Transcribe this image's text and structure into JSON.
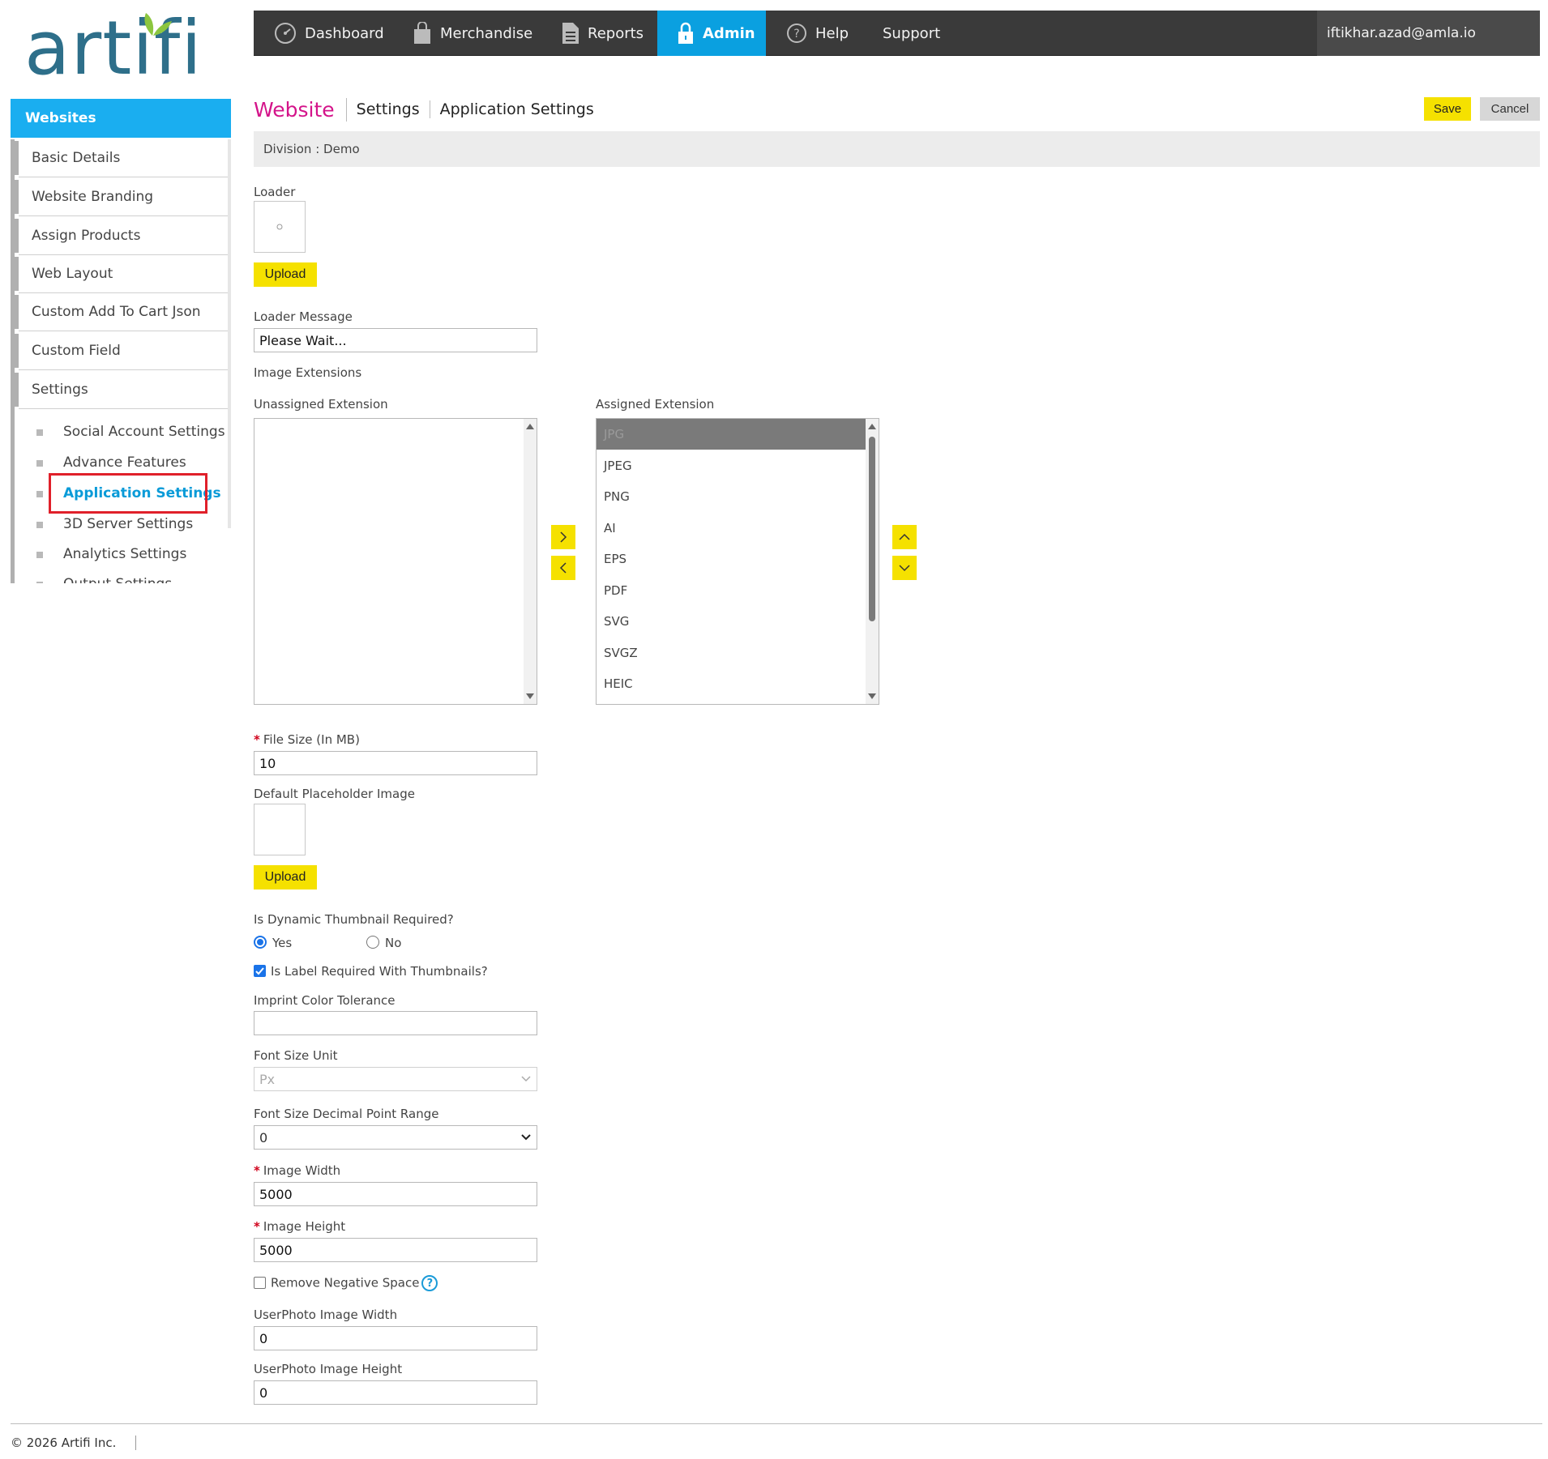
{
  "logo": {
    "text": "artifi"
  },
  "topnav": {
    "items": [
      {
        "label": "Dashboard",
        "icon": "gauge-icon"
      },
      {
        "label": "Merchandise",
        "icon": "bag-icon"
      },
      {
        "label": "Reports",
        "icon": "document-icon"
      },
      {
        "label": "Admin",
        "icon": "lock-icon",
        "active": true
      },
      {
        "label": "Help",
        "icon": "help-circle-icon"
      },
      {
        "label": "Support"
      }
    ],
    "user": "iftikhar.azad@amla.io"
  },
  "sidebar": {
    "header": "Websites",
    "items": [
      "Basic Details",
      "Website Branding",
      "Assign Products",
      "Web Layout",
      "Custom Add To Cart Json",
      "Custom Field",
      "Settings"
    ],
    "sub_items": [
      "Social Account Settings",
      "Advance Features",
      "Application Settings",
      "3D Server Settings",
      "Analytics Settings",
      "Output Settings"
    ],
    "current": "Application Settings"
  },
  "breadcrumb": {
    "part1": "Website",
    "part2": "Settings",
    "part3": "Application Settings"
  },
  "actions": {
    "save": "Save",
    "cancel": "Cancel"
  },
  "division": {
    "label": "Division :",
    "value": "Demo"
  },
  "form": {
    "loader_label": "Loader",
    "upload_label": "Upload",
    "loader_message_label": "Loader Message",
    "loader_message_value": "Please Wait...",
    "image_extensions_label": "Image Extensions",
    "unassigned_label": "Unassigned Extension",
    "assigned_label": "Assigned Extension",
    "assigned_extensions": [
      "JPG",
      "JPEG",
      "PNG",
      "AI",
      "EPS",
      "PDF",
      "SVG",
      "SVGZ",
      "HEIC"
    ],
    "selected_extension": "JPG",
    "file_size_label": "File Size (In MB)",
    "file_size_value": "10",
    "placeholder_label": "Default Placeholder Image",
    "dynamic_thumb_label": "Is Dynamic Thumbnail Required?",
    "yes_label": "Yes",
    "no_label": "No",
    "dynamic_thumb_value": "Yes",
    "label_required_label": "Is Label Required With Thumbnails?",
    "label_required_checked": true,
    "imprint_tolerance_label": "Imprint Color Tolerance",
    "imprint_tolerance_value": "",
    "font_unit_label": "Font Size Unit",
    "font_unit_value": "Px",
    "font_decimal_label": "Font Size Decimal Point Range",
    "font_decimal_value": "0",
    "image_width_label": "Image Width",
    "image_width_value": "5000",
    "image_height_label": "Image Height",
    "image_height_value": "5000",
    "remove_negative_label": "Remove Negative Space",
    "remove_negative_checked": false,
    "userphoto_width_label": "UserPhoto Image Width",
    "userphoto_width_value": "0",
    "userphoto_height_label": "UserPhoto Image Height",
    "userphoto_height_value": "0"
  },
  "footer": {
    "copyright": "© 2026 Artifi Inc."
  },
  "colors": {
    "accent_blue": "#0aa0e0",
    "accent_yellow": "#f5e100",
    "brand_magenta": "#d4148a",
    "nav_bg": "#3a3a3a"
  }
}
